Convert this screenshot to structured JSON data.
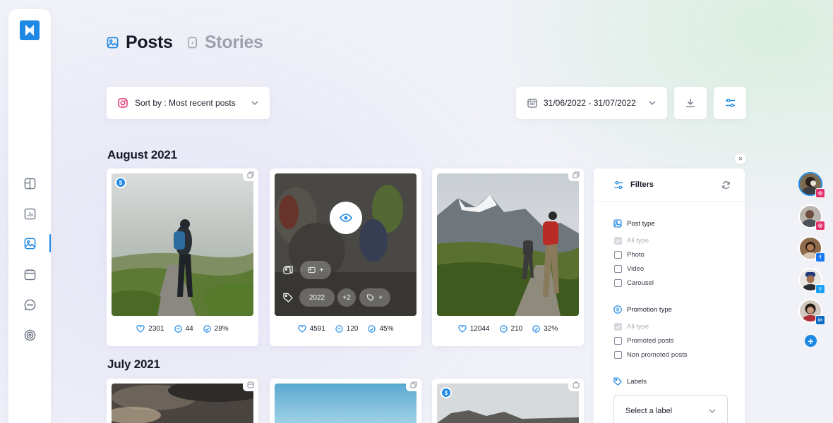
{
  "tabs": [
    {
      "label": "Posts",
      "icon": "image-icon",
      "active": true
    },
    {
      "label": "Stories",
      "icon": "story-icon",
      "active": false
    }
  ],
  "sidebar": {
    "items": [
      {
        "name": "dashboard",
        "icon": "layout-icon"
      },
      {
        "name": "analytics",
        "icon": "chart-icon"
      },
      {
        "name": "posts",
        "icon": "image-icon",
        "active": true
      },
      {
        "name": "calendar",
        "icon": "calendar-icon"
      },
      {
        "name": "messages",
        "icon": "chat-icon"
      },
      {
        "name": "listening",
        "icon": "radar-icon"
      }
    ]
  },
  "toolbar": {
    "sort_label": "Sort by : Most recent posts",
    "date_range": "31/06/2022 - 31/07/2022"
  },
  "months": [
    {
      "label": "August 2021"
    },
    {
      "label": "July 2021"
    }
  ],
  "posts": [
    {
      "likes": "2301",
      "comments": "44",
      "engagement": "28%",
      "promoted": true
    },
    {
      "likes": "4591",
      "comments": "120",
      "engagement": "45%",
      "promoted": false,
      "labels": {
        "year": "2022",
        "more": "+2",
        "add": "+"
      }
    },
    {
      "likes": "12044",
      "comments": "210",
      "engagement": "32%",
      "promoted": false
    }
  ],
  "filters": {
    "title": "Filters",
    "post_type": {
      "title": "Post type",
      "options": [
        {
          "label": "All type",
          "checked": true,
          "disabled": true
        },
        {
          "label": "Photo",
          "checked": false
        },
        {
          "label": "Video",
          "checked": false
        },
        {
          "label": "Carousel",
          "checked": false
        }
      ]
    },
    "promotion_type": {
      "title": "Promotion type",
      "options": [
        {
          "label": "All type",
          "checked": true,
          "disabled": true
        },
        {
          "label": "Promoted posts",
          "checked": false
        },
        {
          "label": "Non promoted posts",
          "checked": false
        }
      ]
    },
    "labels": {
      "title": "Labels",
      "placeholder": "Select a label"
    }
  },
  "accounts": [
    {
      "network": "instagram",
      "color": "#e1306c",
      "selected": true
    },
    {
      "network": "instagram",
      "color": "#e1306c"
    },
    {
      "network": "facebook",
      "color": "#1877f2"
    },
    {
      "network": "twitter",
      "color": "#1da1f2"
    },
    {
      "network": "linkedin",
      "color": "#0a66c2"
    }
  ],
  "colors": {
    "accent": "#1e88e5"
  }
}
